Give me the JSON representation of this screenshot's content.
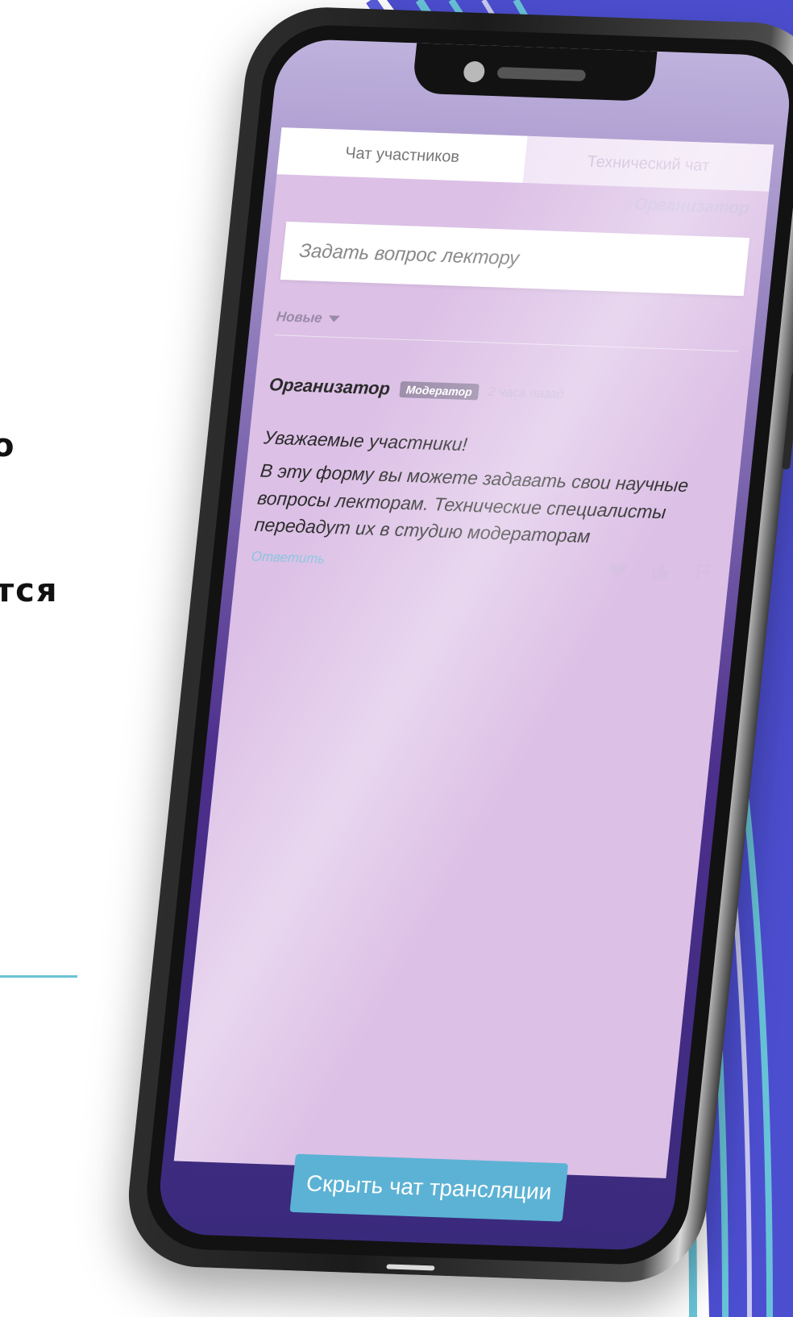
{
  "background_text": {
    "line1": "о",
    "line2": "тся"
  },
  "colors": {
    "accent_blue": "#5cb2d4",
    "wave_purple": "#4c4ed0",
    "wave_cyan": "#69c3d8",
    "chat_bg": "#dcc0e6"
  },
  "chat": {
    "tabs": [
      {
        "label": "Чат участников",
        "active": true
      },
      {
        "label": "Технический чат",
        "active": false
      }
    ],
    "organizer_line": ". Организатор",
    "question_placeholder": "Задать вопрос лектору",
    "sort_label": "Новые",
    "message": {
      "author": "Организатор",
      "role_badge": "Модератор",
      "time": "2 часа назад",
      "greeting": "Уважаемые участники!",
      "body": "В эту форму вы можете задавать свои научные вопросы лекторам. Технические специалисты передадут их в студию модераторам",
      "reply_label": "Ответить",
      "reaction_icons": [
        "heart-icon",
        "thumbs-up-icon",
        "flag-icon"
      ]
    },
    "hide_button_label": "Скрыть чат трансляции"
  }
}
